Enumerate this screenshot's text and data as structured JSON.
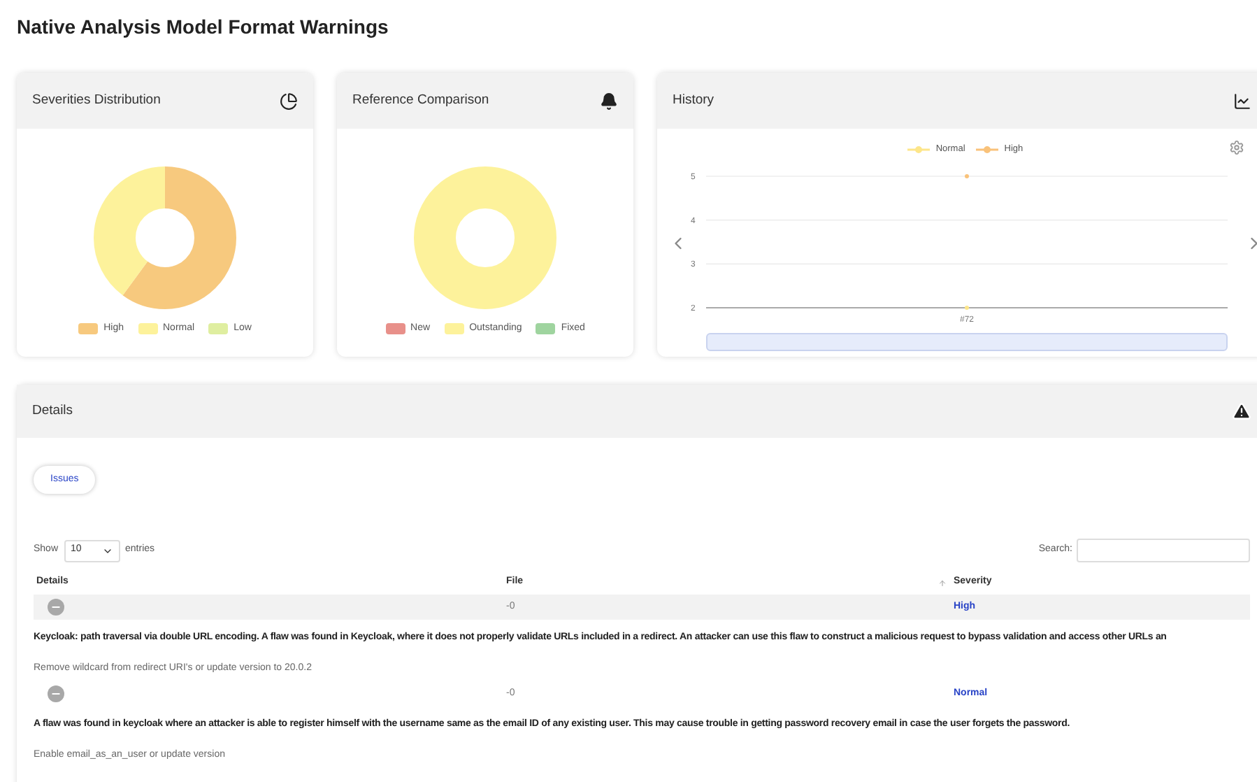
{
  "page": {
    "title": "Native Analysis Model Format Warnings"
  },
  "cards": [
    {
      "kind": "donut",
      "title": "Severities Distribution",
      "legend": [
        {
          "label": "High",
          "color": "#f7c97e"
        },
        {
          "label": "Normal",
          "color": "#fdf29b"
        },
        {
          "label": "Low",
          "color": "#dfeea0"
        }
      ]
    },
    {
      "kind": "donut",
      "title": "Reference Comparison",
      "legend": [
        {
          "label": "New",
          "color": "#e8908a"
        },
        {
          "label": "Outstanding",
          "color": "#fdf29b"
        },
        {
          "label": "Fixed",
          "color": "#9fd49f"
        }
      ]
    },
    {
      "kind": "history",
      "title": "History",
      "chart_data": {
        "type": "line",
        "categories": [
          "#72"
        ],
        "yticks": [
          2,
          3,
          4,
          5
        ],
        "ylim": [
          2,
          5
        ],
        "series": [
          {
            "name": "Normal",
            "color": "#fde68a",
            "marker": "circle",
            "values": [
              2
            ]
          },
          {
            "name": "High",
            "color": "#f9c27a",
            "marker": "circle",
            "values": [
              5
            ]
          }
        ]
      }
    }
  ],
  "details": {
    "title": "Details",
    "tabs": [
      {
        "label": "Issues",
        "selected": true
      }
    ],
    "length": {
      "prefix": "Show",
      "value": "10",
      "suffix": "entries"
    },
    "search": {
      "label": "Search:"
    },
    "columns": [
      "Details",
      "File",
      "Severity"
    ],
    "rows": [
      {
        "expanded": true,
        "file": "-0",
        "severity": "High",
        "description": "Keycloak: path traversal via double URL encoding. A flaw was found in Keycloak, where it does not properly validate URLs included in a redirect. An attacker can use this flaw to construct a malicious request to bypass validation and access other URLs an",
        "recommendation": "Remove wildcard from redirect URI's or update version to 20.0.2"
      },
      {
        "expanded": true,
        "file": "-0",
        "severity": "Normal",
        "description": "A flaw was found in keycloak where an attacker is able to register himself with the username same as the email ID of any existing user. This may cause trouble in getting password recovery email in case the user forgets the password.",
        "recommendation": "Enable email_as_an_user or update version"
      }
    ]
  }
}
